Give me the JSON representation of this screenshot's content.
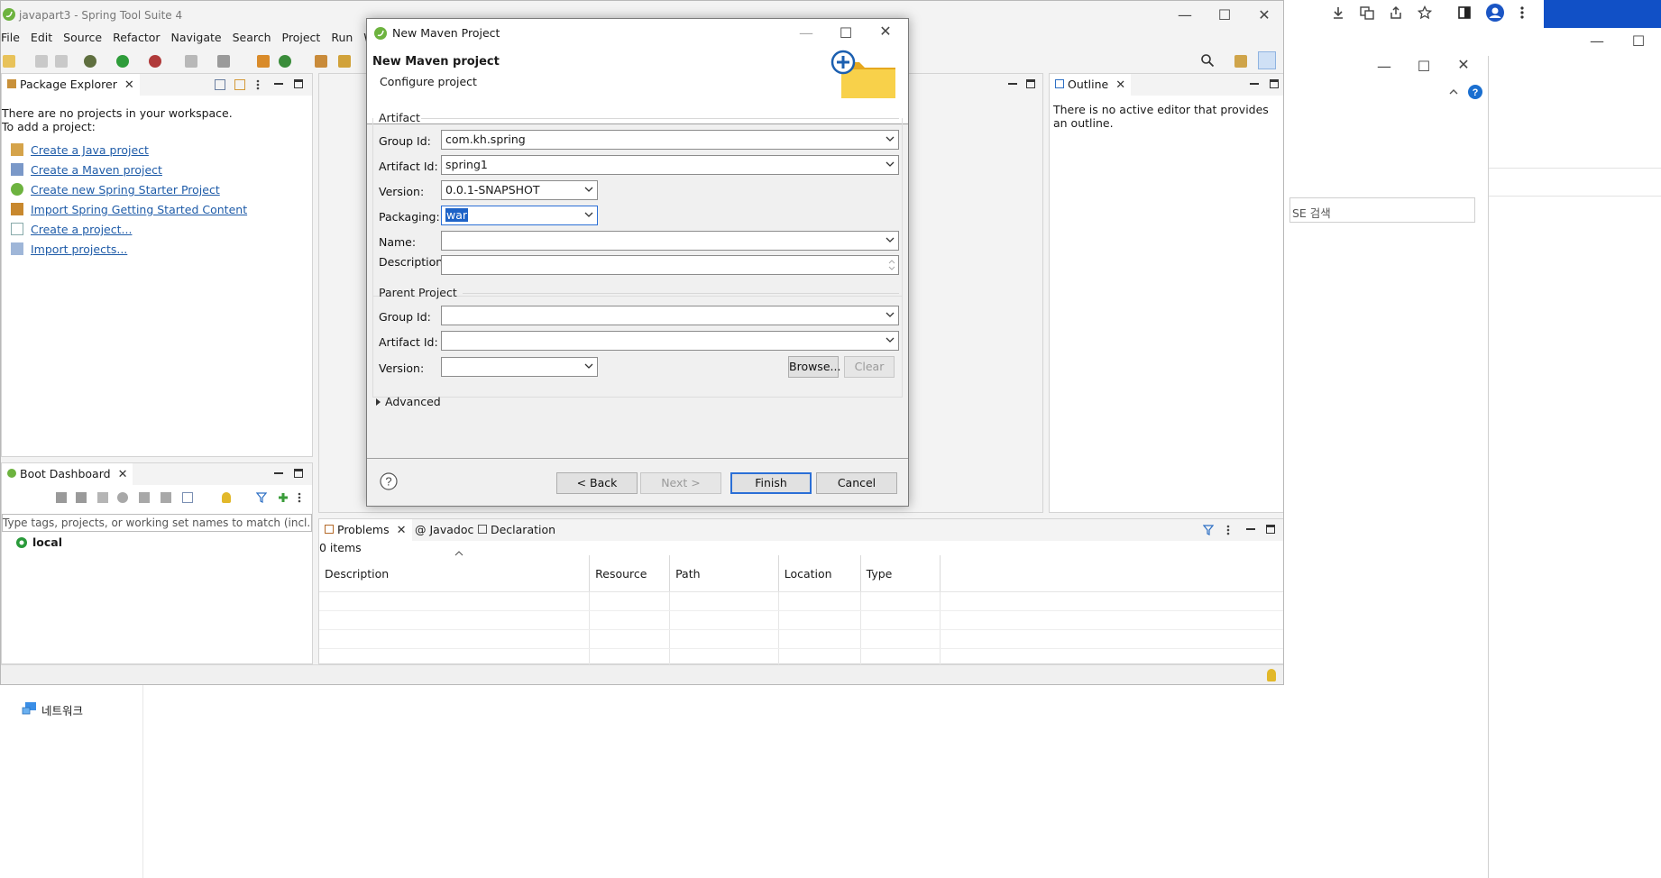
{
  "ide": {
    "title": "javapart3 - Spring Tool Suite 4",
    "menu": [
      "File",
      "Edit",
      "Source",
      "Refactor",
      "Navigate",
      "Search",
      "Project",
      "Run",
      "Windo"
    ]
  },
  "package_explorer": {
    "tab": "Package Explorer",
    "msg1": "There are no projects in your workspace.",
    "msg2": "To add a project:",
    "links": [
      "Create a Java project",
      "Create a Maven project",
      "Create new Spring Starter Project",
      "Import Spring Getting Started Content",
      "Create a project...",
      "Import projects..."
    ]
  },
  "outline": {
    "tab": "Outline",
    "msg": "There is no active editor that provides an outline."
  },
  "boot_dashboard": {
    "tab": "Boot Dashboard",
    "filter_placeholder": "Type tags, projects, or working set names to match (incl. * and",
    "local": "local"
  },
  "problems": {
    "tabs": [
      "Problems",
      "Javadoc",
      "Declaration"
    ],
    "count": "0 items",
    "columns": [
      "Description",
      "Resource",
      "Path",
      "Location",
      "Type"
    ]
  },
  "dialog": {
    "title": "New Maven Project",
    "heading": "New Maven project",
    "subheading": "Configure project",
    "artifact_group": "Artifact",
    "labels": {
      "group_id": "Group Id:",
      "artifact_id": "Artifact Id:",
      "version": "Version:",
      "packaging": "Packaging:",
      "name": "Name:",
      "description": "Description:"
    },
    "values": {
      "group_id": "com.kh.spring",
      "artifact_id": "spring1",
      "version": "0.0.1-SNAPSHOT",
      "packaging": "war",
      "name": "",
      "description": ""
    },
    "parent_group": "Parent Project",
    "parent_labels": {
      "group_id": "Group Id:",
      "artifact_id": "Artifact Id:",
      "version": "Version:"
    },
    "browse": "Browse...",
    "clear": "Clear",
    "advanced": "Advanced",
    "back": "< Back",
    "next": "Next >",
    "finish": "Finish",
    "cancel": "Cancel"
  },
  "background": {
    "search_text": "SE 검색",
    "network": "네트워크"
  },
  "colors": {
    "accent": "#2b6fd6",
    "link": "#1e5ba8",
    "browser_blue": "#1150c6",
    "spring_green": "#6db33f"
  }
}
